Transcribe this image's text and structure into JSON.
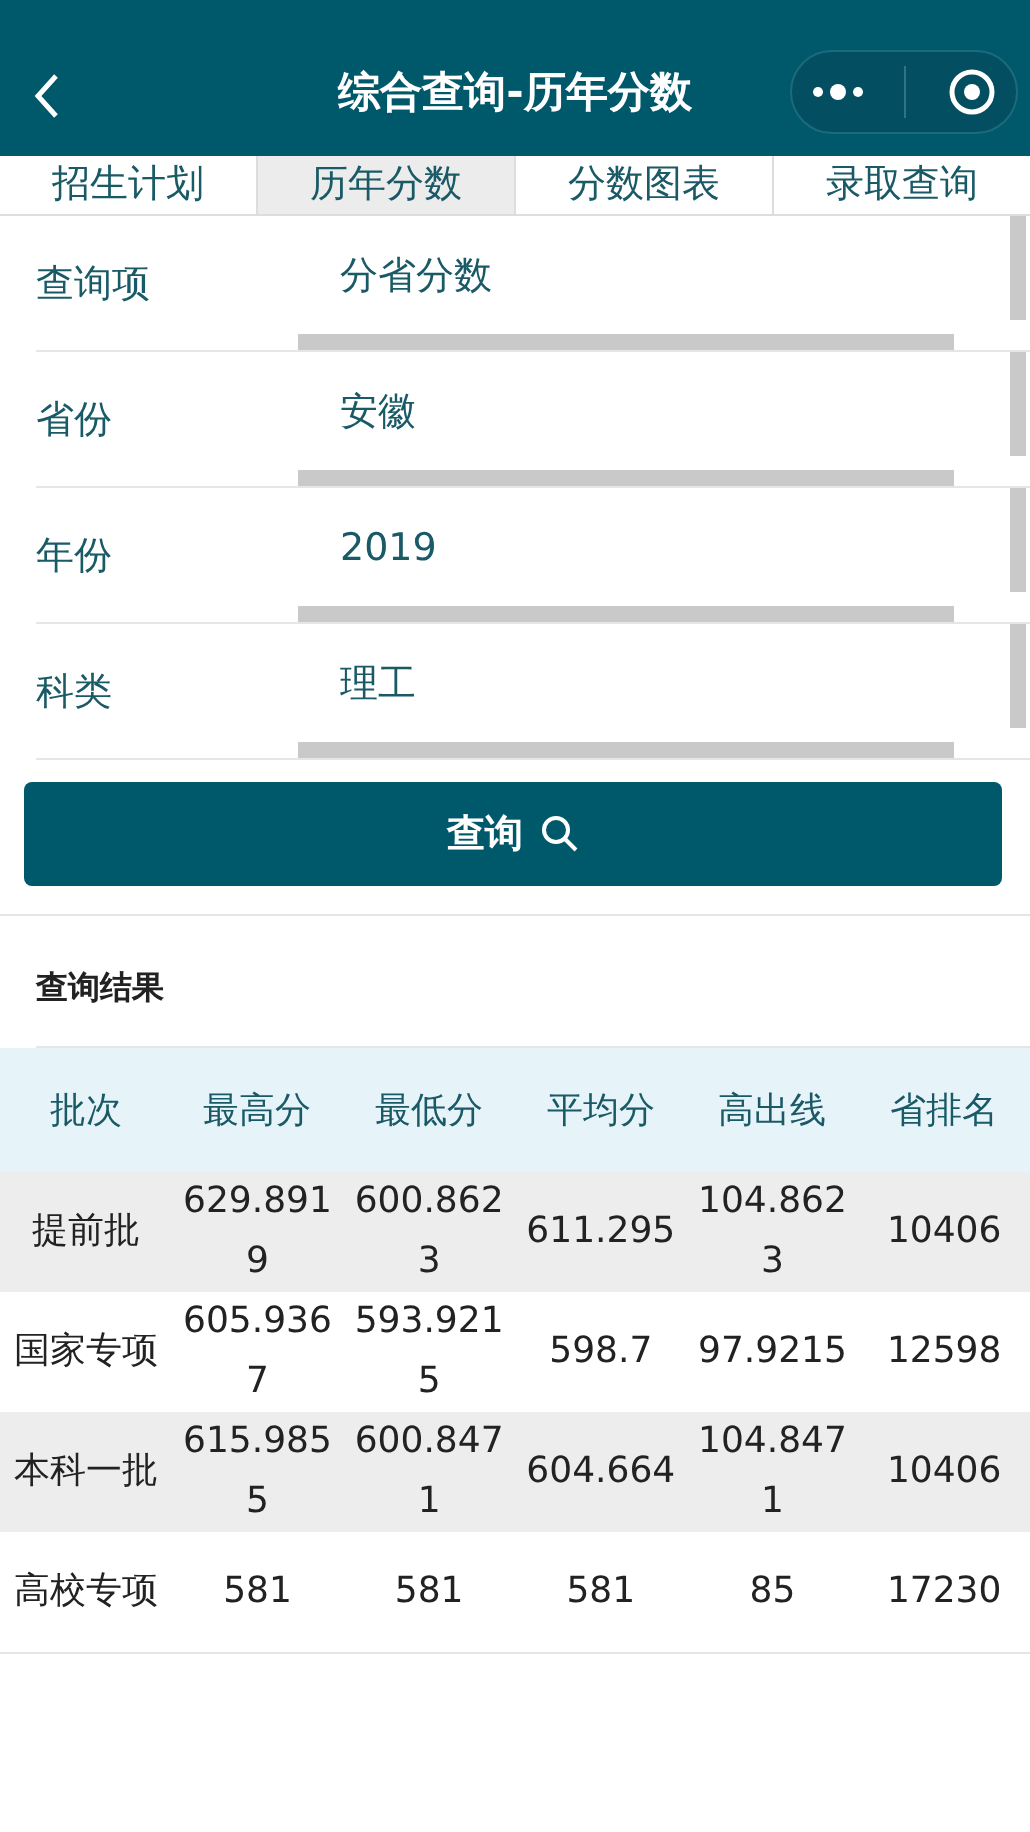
{
  "header": {
    "title": "综合查询-历年分数"
  },
  "tabs": [
    {
      "label": "招生计划",
      "selected": false
    },
    {
      "label": "历年分数",
      "selected": true
    },
    {
      "label": "分数图表",
      "selected": false
    },
    {
      "label": "录取查询",
      "selected": false
    }
  ],
  "form": [
    {
      "label": "查询项",
      "value": "分省分数"
    },
    {
      "label": "省份",
      "value": "安徽"
    },
    {
      "label": "年份",
      "value": "2019"
    },
    {
      "label": "科类",
      "value": "理工"
    }
  ],
  "query_button": {
    "label": "查询"
  },
  "results": {
    "title": "查询结果",
    "columns": [
      "批次",
      "最高分",
      "最低分",
      "平均分",
      "高出线",
      "省排名"
    ],
    "rows": [
      [
        "提前批",
        "629.8919",
        "600.8623",
        "611.295",
        "104.8623",
        "10406"
      ],
      [
        "国家专项",
        "605.9367",
        "593.9215",
        "598.7",
        "97.9215",
        "12598"
      ],
      [
        "本科一批",
        "615.9855",
        "600.8471",
        "604.664",
        "104.8471",
        "10406"
      ],
      [
        "高校专项",
        "581",
        "581",
        "581",
        "85",
        "17230"
      ]
    ]
  }
}
